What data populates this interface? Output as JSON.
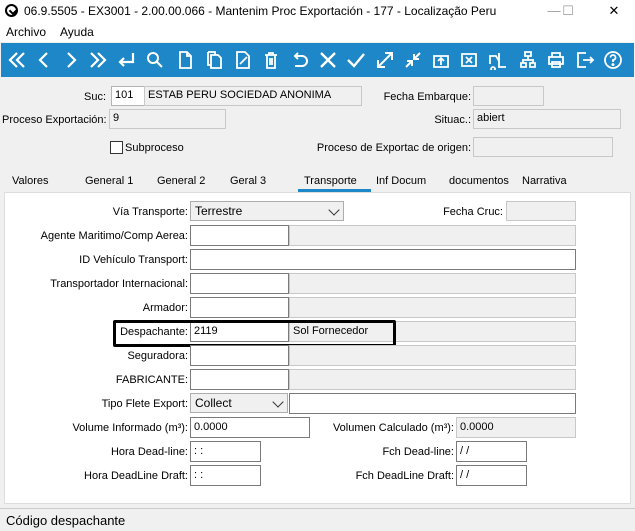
{
  "window": {
    "title": "06.9.5505 - EX3001 - 2.00.00.066 - Mantenim Proc Exportación - 177 - Localização Peru",
    "minimize": "—",
    "maximize": "☐",
    "close": "✕"
  },
  "menu": [
    "Archivo",
    "Ayuda"
  ],
  "toolbar": {
    "icons": [
      "first-icon",
      "prev-icon",
      "next-icon",
      "last-icon",
      "enter-icon",
      "search-icon",
      "new-icon",
      "copy-icon",
      "edit-icon",
      "delete-icon",
      "undo-icon",
      "cancel-icon",
      "confirm-icon",
      "expand-icon",
      "shrink-icon",
      "upload-icon",
      "close-box-icon",
      "forklift-icon",
      "structure-icon",
      "print-icon",
      "exit-icon",
      "help-icon"
    ],
    "color": "#1e87c8"
  },
  "header": {
    "suc_label": "Suc:",
    "suc_code": "101",
    "suc_name": "ESTAB PERU SOCIEDAD ANONIMA",
    "fecha_embarque_label": "Fecha Embarque:",
    "fecha_embarque": "",
    "proceso_label": "Proceso Exportación:",
    "proceso": "9",
    "situac_label": "Situac.:",
    "situac": "abiert",
    "subproceso_label": "Subproceso",
    "subproceso_checked": false,
    "proceso_origen_label": "Proceso de Exportac de origen:",
    "proceso_origen": ""
  },
  "tabs": [
    {
      "label": "Valores"
    },
    {
      "label": "General 1"
    },
    {
      "label": "General 2"
    },
    {
      "label": "Geral 3"
    },
    {
      "label": "Transporte",
      "active": true
    },
    {
      "label": "Inf Docum"
    },
    {
      "label": "documentos"
    },
    {
      "label": "Narrativa"
    }
  ],
  "form": {
    "via_label": "Vía Transporte:",
    "via_value": "Terrestre",
    "fecha_cruc_label": "Fecha Cruc:",
    "fecha_cruc": "",
    "agente_label": "Agente Maritimo/Comp Aerea:",
    "agente": "",
    "id_vehiculo_label": "ID Vehículo Transport:",
    "id_vehiculo": "",
    "transportador_label": "Transportador Internacional:",
    "transportador": "",
    "armador_label": "Armador:",
    "armador": "",
    "despachante_label": "Despachante:",
    "despachante_code": "2119",
    "despachante_name": "Sol Fornecedor",
    "seguradora_label": "Seguradora:",
    "seguradora": "",
    "fabricante_label": "FABRICANTE:",
    "fabricante": "",
    "tipo_flete_label": "Tipo Flete Export:",
    "tipo_flete_value": "Collect",
    "volumen_inf_label": "Volume Informado (m³):",
    "volumen_inf": "0.0000",
    "volumen_calc_label": "Volumen Calculado (m³):",
    "volumen_calc": "0.0000",
    "hora_deadline_label": "Hora Dead-line:",
    "hora_deadline": " :  :",
    "fch_deadline_label": "Fch Dead-line:",
    "fch_deadline": " /  /",
    "hora_deadline_draft_label": "Hora DeadLine Draft:",
    "hora_deadline_draft": " :  :",
    "fch_deadline_draft_label": "Fch DeadLine Draft:",
    "fch_deadline_draft": " /  /"
  },
  "status": {
    "text": "Código despachante"
  }
}
